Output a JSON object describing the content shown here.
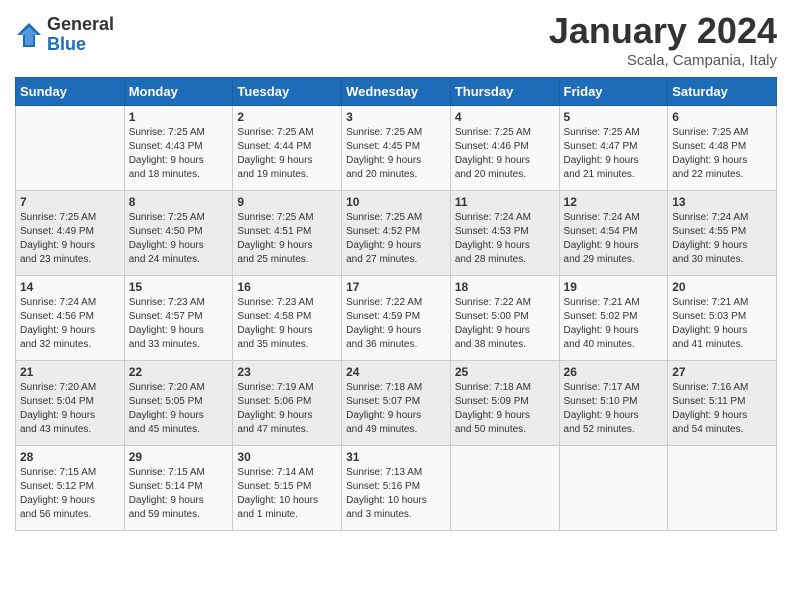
{
  "header": {
    "logo_general": "General",
    "logo_blue": "Blue",
    "month_title": "January 2024",
    "location": "Scala, Campania, Italy"
  },
  "weekdays": [
    "Sunday",
    "Monday",
    "Tuesday",
    "Wednesday",
    "Thursday",
    "Friday",
    "Saturday"
  ],
  "rows": [
    [
      {
        "day": "",
        "lines": []
      },
      {
        "day": "1",
        "lines": [
          "Sunrise: 7:25 AM",
          "Sunset: 4:43 PM",
          "Daylight: 9 hours",
          "and 18 minutes."
        ]
      },
      {
        "day": "2",
        "lines": [
          "Sunrise: 7:25 AM",
          "Sunset: 4:44 PM",
          "Daylight: 9 hours",
          "and 19 minutes."
        ]
      },
      {
        "day": "3",
        "lines": [
          "Sunrise: 7:25 AM",
          "Sunset: 4:45 PM",
          "Daylight: 9 hours",
          "and 20 minutes."
        ]
      },
      {
        "day": "4",
        "lines": [
          "Sunrise: 7:25 AM",
          "Sunset: 4:46 PM",
          "Daylight: 9 hours",
          "and 20 minutes."
        ]
      },
      {
        "day": "5",
        "lines": [
          "Sunrise: 7:25 AM",
          "Sunset: 4:47 PM",
          "Daylight: 9 hours",
          "and 21 minutes."
        ]
      },
      {
        "day": "6",
        "lines": [
          "Sunrise: 7:25 AM",
          "Sunset: 4:48 PM",
          "Daylight: 9 hours",
          "and 22 minutes."
        ]
      }
    ],
    [
      {
        "day": "7",
        "lines": [
          "Sunrise: 7:25 AM",
          "Sunset: 4:49 PM",
          "Daylight: 9 hours",
          "and 23 minutes."
        ]
      },
      {
        "day": "8",
        "lines": [
          "Sunrise: 7:25 AM",
          "Sunset: 4:50 PM",
          "Daylight: 9 hours",
          "and 24 minutes."
        ]
      },
      {
        "day": "9",
        "lines": [
          "Sunrise: 7:25 AM",
          "Sunset: 4:51 PM",
          "Daylight: 9 hours",
          "and 25 minutes."
        ]
      },
      {
        "day": "10",
        "lines": [
          "Sunrise: 7:25 AM",
          "Sunset: 4:52 PM",
          "Daylight: 9 hours",
          "and 27 minutes."
        ]
      },
      {
        "day": "11",
        "lines": [
          "Sunrise: 7:24 AM",
          "Sunset: 4:53 PM",
          "Daylight: 9 hours",
          "and 28 minutes."
        ]
      },
      {
        "day": "12",
        "lines": [
          "Sunrise: 7:24 AM",
          "Sunset: 4:54 PM",
          "Daylight: 9 hours",
          "and 29 minutes."
        ]
      },
      {
        "day": "13",
        "lines": [
          "Sunrise: 7:24 AM",
          "Sunset: 4:55 PM",
          "Daylight: 9 hours",
          "and 30 minutes."
        ]
      }
    ],
    [
      {
        "day": "14",
        "lines": [
          "Sunrise: 7:24 AM",
          "Sunset: 4:56 PM",
          "Daylight: 9 hours",
          "and 32 minutes."
        ]
      },
      {
        "day": "15",
        "lines": [
          "Sunrise: 7:23 AM",
          "Sunset: 4:57 PM",
          "Daylight: 9 hours",
          "and 33 minutes."
        ]
      },
      {
        "day": "16",
        "lines": [
          "Sunrise: 7:23 AM",
          "Sunset: 4:58 PM",
          "Daylight: 9 hours",
          "and 35 minutes."
        ]
      },
      {
        "day": "17",
        "lines": [
          "Sunrise: 7:22 AM",
          "Sunset: 4:59 PM",
          "Daylight: 9 hours",
          "and 36 minutes."
        ]
      },
      {
        "day": "18",
        "lines": [
          "Sunrise: 7:22 AM",
          "Sunset: 5:00 PM",
          "Daylight: 9 hours",
          "and 38 minutes."
        ]
      },
      {
        "day": "19",
        "lines": [
          "Sunrise: 7:21 AM",
          "Sunset: 5:02 PM",
          "Daylight: 9 hours",
          "and 40 minutes."
        ]
      },
      {
        "day": "20",
        "lines": [
          "Sunrise: 7:21 AM",
          "Sunset: 5:03 PM",
          "Daylight: 9 hours",
          "and 41 minutes."
        ]
      }
    ],
    [
      {
        "day": "21",
        "lines": [
          "Sunrise: 7:20 AM",
          "Sunset: 5:04 PM",
          "Daylight: 9 hours",
          "and 43 minutes."
        ]
      },
      {
        "day": "22",
        "lines": [
          "Sunrise: 7:20 AM",
          "Sunset: 5:05 PM",
          "Daylight: 9 hours",
          "and 45 minutes."
        ]
      },
      {
        "day": "23",
        "lines": [
          "Sunrise: 7:19 AM",
          "Sunset: 5:06 PM",
          "Daylight: 9 hours",
          "and 47 minutes."
        ]
      },
      {
        "day": "24",
        "lines": [
          "Sunrise: 7:18 AM",
          "Sunset: 5:07 PM",
          "Daylight: 9 hours",
          "and 49 minutes."
        ]
      },
      {
        "day": "25",
        "lines": [
          "Sunrise: 7:18 AM",
          "Sunset: 5:09 PM",
          "Daylight: 9 hours",
          "and 50 minutes."
        ]
      },
      {
        "day": "26",
        "lines": [
          "Sunrise: 7:17 AM",
          "Sunset: 5:10 PM",
          "Daylight: 9 hours",
          "and 52 minutes."
        ]
      },
      {
        "day": "27",
        "lines": [
          "Sunrise: 7:16 AM",
          "Sunset: 5:11 PM",
          "Daylight: 9 hours",
          "and 54 minutes."
        ]
      }
    ],
    [
      {
        "day": "28",
        "lines": [
          "Sunrise: 7:15 AM",
          "Sunset: 5:12 PM",
          "Daylight: 9 hours",
          "and 56 minutes."
        ]
      },
      {
        "day": "29",
        "lines": [
          "Sunrise: 7:15 AM",
          "Sunset: 5:14 PM",
          "Daylight: 9 hours",
          "and 59 minutes."
        ]
      },
      {
        "day": "30",
        "lines": [
          "Sunrise: 7:14 AM",
          "Sunset: 5:15 PM",
          "Daylight: 10 hours",
          "and 1 minute."
        ]
      },
      {
        "day": "31",
        "lines": [
          "Sunrise: 7:13 AM",
          "Sunset: 5:16 PM",
          "Daylight: 10 hours",
          "and 3 minutes."
        ]
      },
      {
        "day": "",
        "lines": []
      },
      {
        "day": "",
        "lines": []
      },
      {
        "day": "",
        "lines": []
      }
    ]
  ]
}
